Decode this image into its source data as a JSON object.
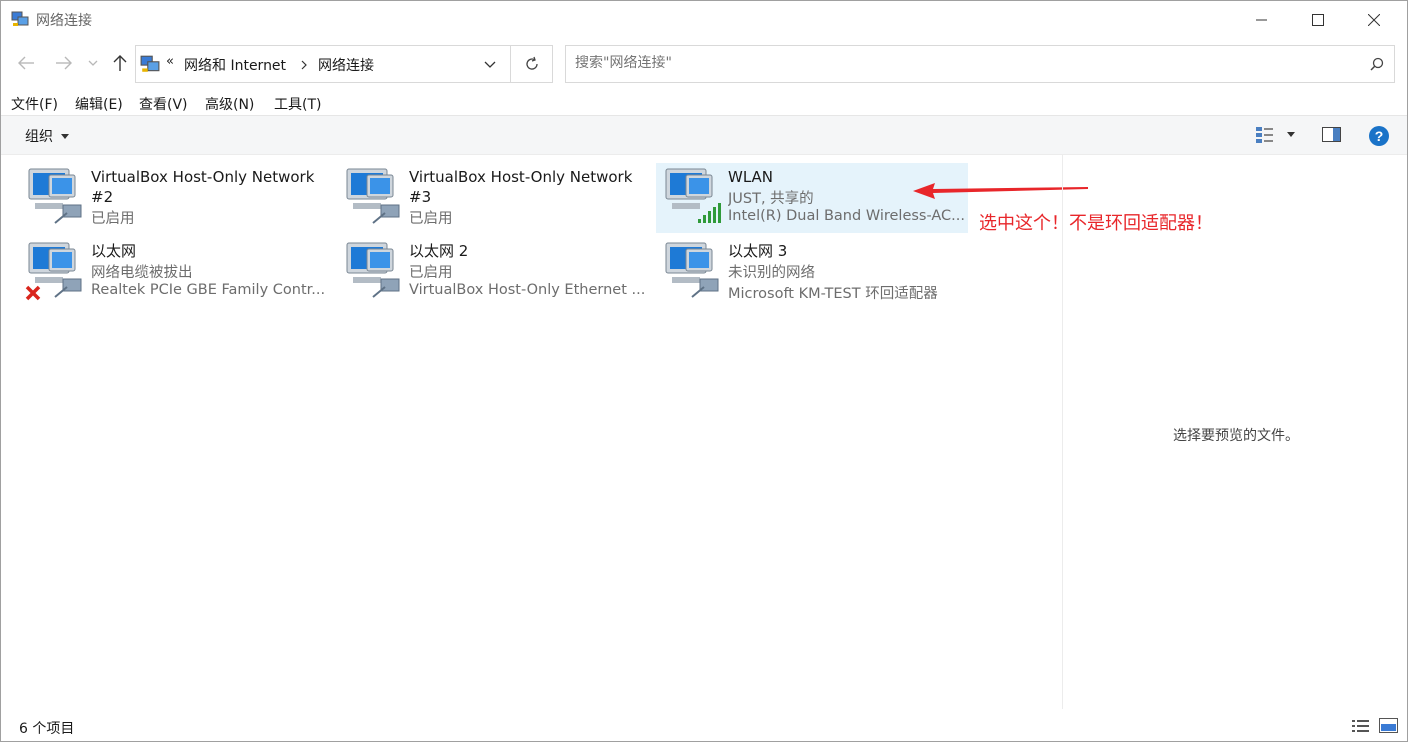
{
  "window": {
    "title": "网络连接"
  },
  "address": {
    "overflow": "«",
    "crumbs": [
      "网络和 Internet",
      "网络连接"
    ],
    "search_placeholder": "搜索\"网络连接\""
  },
  "menu": {
    "items": [
      "文件(F)",
      "编辑(E)",
      "查看(V)",
      "高级(N)",
      "工具(T)"
    ]
  },
  "toolbar": {
    "organize_label": "组织"
  },
  "connections": [
    {
      "name_line1": "VirtualBox Host-Only Network",
      "name_line2": "#2",
      "status": "已启用",
      "device": "",
      "icon": "ethernet-icon"
    },
    {
      "name_line1": "VirtualBox Host-Only Network",
      "name_line2": "#3",
      "status": "已启用",
      "device": "",
      "icon": "ethernet-icon"
    },
    {
      "name_line1": "WLAN",
      "name_line2": "",
      "status": "JUST, 共享的",
      "device": "Intel(R) Dual Band Wireless-AC...",
      "icon": "wifi-icon",
      "selected": true
    },
    {
      "name_line1": "以太网",
      "name_line2": "",
      "status": "网络电缆被拔出",
      "device": "Realtek PCIe GBE Family Contr...",
      "icon": "ethernet-disconnected-icon"
    },
    {
      "name_line1": "以太网 2",
      "name_line2": "",
      "status": "已启用",
      "device": "VirtualBox Host-Only Ethernet ...",
      "icon": "ethernet-icon"
    },
    {
      "name_line1": "以太网 3",
      "name_line2": "",
      "status": "未识别的网络",
      "device": "Microsoft KM-TEST 环回适配器",
      "icon": "ethernet-icon"
    }
  ],
  "annotation": {
    "text": "选中这个！不是环回适配器！",
    "color": "#e8262a"
  },
  "preview": {
    "text": "选择要预览的文件。"
  },
  "status": {
    "count": "6 个项目"
  },
  "colors": {
    "selection": "#e5f3fb",
    "help": "#1a73c8"
  }
}
